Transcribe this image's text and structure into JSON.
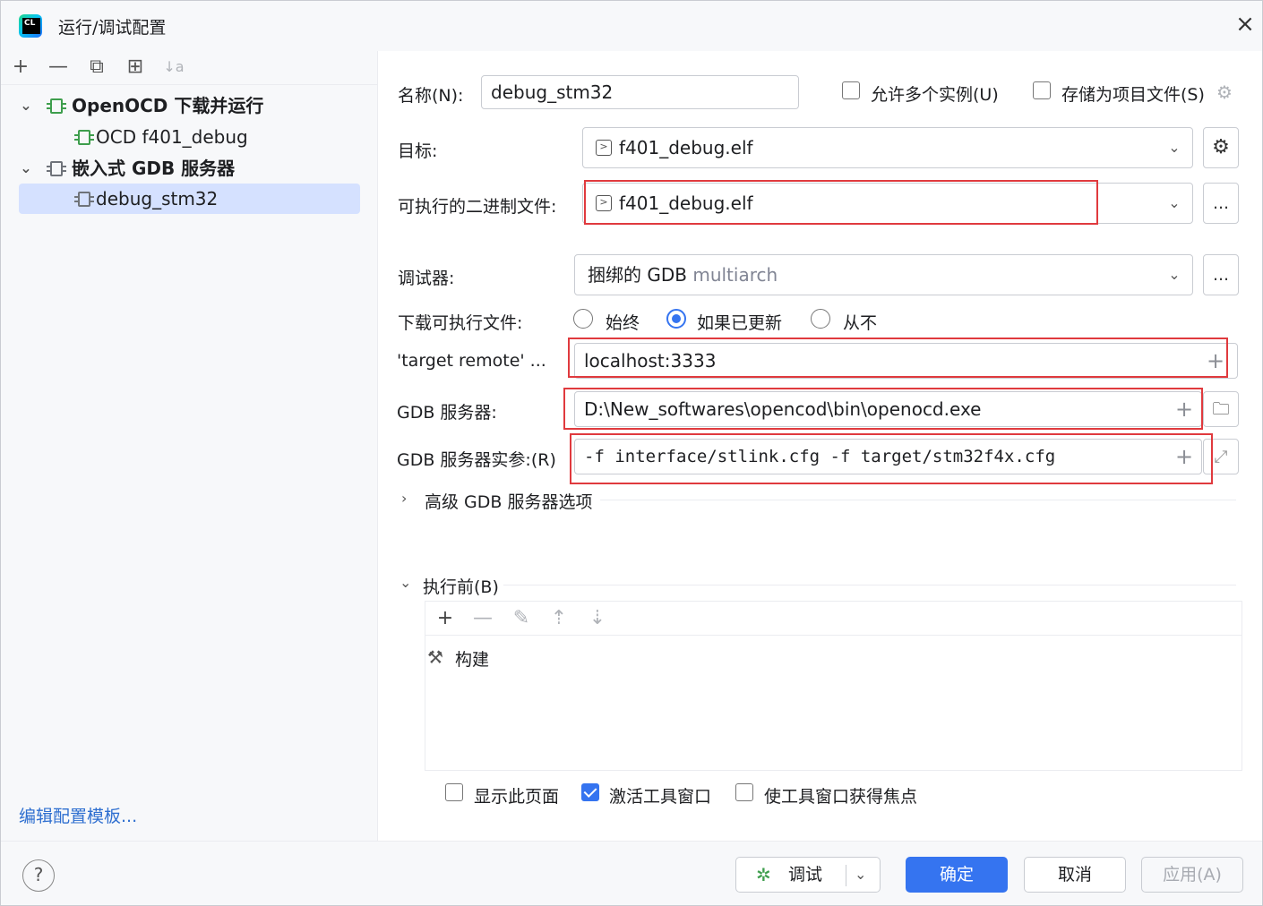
{
  "window": {
    "title": "运行/调试配置"
  },
  "sidebar": {
    "toolbar": {
      "add": "+",
      "remove": "—",
      "copy": "⧉",
      "folder": "⊞",
      "sort": "↓a"
    },
    "tree": [
      {
        "label": "OpenOCD 下载并运行"
      },
      {
        "label": "OCD f401_debug"
      },
      {
        "label": "嵌入式 GDB 服务器"
      },
      {
        "label": "debug_stm32"
      }
    ],
    "edit_templates": "编辑配置模板..."
  },
  "form": {
    "name_label": "名称(N):",
    "name_value": "debug_stm32",
    "allow_multiple_label": "允许多个实例(U)",
    "store_as_project_label": "存储为项目文件(S)",
    "target_label": "目标:",
    "target_value": "f401_debug.elf",
    "executable_label": "可执行的二进制文件:",
    "executable_value": "f401_debug.elf",
    "debugger_label": "调试器:",
    "debugger_value": "捆绑的 GDB",
    "debugger_hint": "multiarch",
    "download_label": "下载可执行文件:",
    "download_options": [
      "始终",
      "如果已更新",
      "从不"
    ],
    "download_selected": "如果已更新",
    "target_remote_label": "'target remote' ...",
    "target_remote_value": "localhost:3333",
    "gdb_server_label": "GDB 服务器:",
    "gdb_server_value": "D:\\New_softwares\\opencod\\bin\\openocd.exe",
    "gdb_args_label": "GDB 服务器实参:(R)",
    "gdb_args_value": "-f interface/stlink.cfg -f target/stm32f4x.cfg",
    "advanced_label": "高级 GDB 服务器选项",
    "before_label": "执行前(B)",
    "before_items": [
      "构建"
    ],
    "show_page_label": "显示此页面",
    "activate_tool_window_label": "激活工具窗口",
    "focus_tool_window_label": "使工具窗口获得焦点",
    "browse_label": "..."
  },
  "states": {
    "allow_multiple": false,
    "store_as_project": false,
    "show_page": false,
    "activate_tool_window": true,
    "focus_tool_window": false
  },
  "buttons": {
    "help": "?",
    "debug": "调试",
    "ok": "确定",
    "cancel": "取消",
    "apply": "应用(A)"
  },
  "colors": {
    "accent": "#3574f0",
    "highlight_box": "#e03a3e",
    "selection": "#d5e1ff"
  }
}
